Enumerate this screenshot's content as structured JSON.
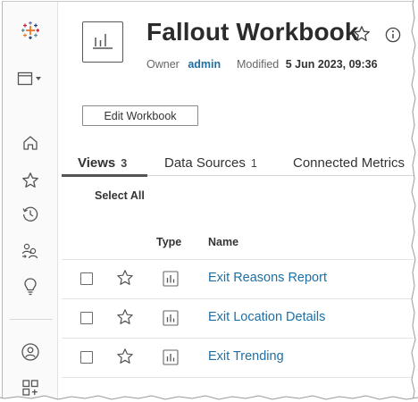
{
  "rail": {
    "items": [
      {
        "icon": "tableau-logo-icon"
      },
      {
        "icon": "browse-menu-icon"
      },
      {
        "icon": "home-icon"
      },
      {
        "icon": "favorites-star-icon"
      },
      {
        "icon": "recents-clock-icon"
      },
      {
        "icon": "shared-with-me-icon"
      },
      {
        "icon": "recommendations-lightbulb-icon"
      },
      {
        "icon": "user-profile-icon"
      },
      {
        "icon": "collections-grid-icon"
      }
    ]
  },
  "header": {
    "title": "Fallout Workbook",
    "owner_label": "Owner",
    "owner": "admin",
    "modified_label": "Modified",
    "modified": "5 Jun 2023, 09:36"
  },
  "actions": {
    "edit_label": "Edit Workbook"
  },
  "tabs": [
    {
      "label": "Views",
      "count": "3",
      "active": true
    },
    {
      "label": "Data Sources",
      "count": "1",
      "active": false
    },
    {
      "label": "Connected Metrics",
      "count": "",
      "active": false
    }
  ],
  "select_all_label": "Select All",
  "table": {
    "columns": [
      "Type",
      "Name"
    ],
    "rows": [
      {
        "name": "Exit Reasons Report",
        "type_icon": "view-chart-icon"
      },
      {
        "name": "Exit Location Details",
        "type_icon": "view-chart-icon"
      },
      {
        "name": "Exit Trending",
        "type_icon": "view-chart-icon"
      }
    ]
  },
  "colors": {
    "link": "#1f6fa3",
    "text": "#333333",
    "logo_blue": "#1f457e",
    "logo_orange": "#e8762d",
    "logo_red": "#c72037",
    "logo_teal": "#5b879b",
    "logo_purple": "#7c73b5"
  }
}
